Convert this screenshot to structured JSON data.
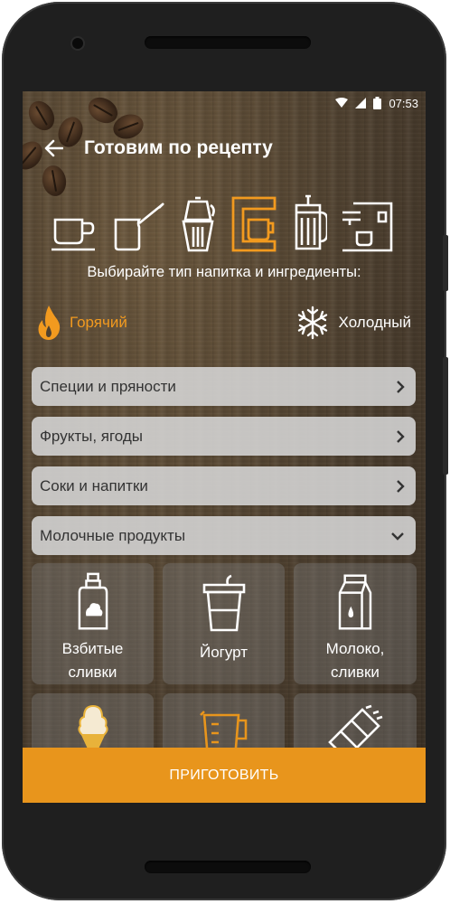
{
  "status_bar": {
    "time": "07:53"
  },
  "app_bar": {
    "title": "Готовим по рецепту",
    "back_icon": "arrow-left-icon"
  },
  "brew_methods": [
    {
      "name": "cup",
      "selected": false
    },
    {
      "name": "cezve",
      "selected": false
    },
    {
      "name": "moka-pot",
      "selected": false
    },
    {
      "name": "drip-coffee-maker",
      "selected": true
    },
    {
      "name": "french-press",
      "selected": false
    },
    {
      "name": "espresso-machine",
      "selected": false
    }
  ],
  "prompt": "Выбирайте тип напитка и ингредиенты:",
  "temperature": {
    "hot_label": "Горячий",
    "cold_label": "Холодный",
    "selected": "hot"
  },
  "categories": [
    {
      "label": "Специи и пряности",
      "icon": "chevron-right-icon"
    },
    {
      "label": "Фрукты, ягоды",
      "icon": "chevron-right-icon"
    },
    {
      "label": "Соки и напитки",
      "icon": "chevron-right-icon"
    },
    {
      "label": "Молочные продукты",
      "icon": "chevron-down-icon"
    }
  ],
  "dairy_items": [
    {
      "label": "Взбитые\nсливки",
      "icon": "whipped-cream-icon"
    },
    {
      "label": "Йогурт",
      "icon": "yogurt-icon"
    },
    {
      "label": "Молоко,\nсливки",
      "icon": "milk-carton-icon"
    },
    {
      "label": "",
      "icon": "ice-cream-icon"
    },
    {
      "label": "",
      "icon": "measuring-jug-icon"
    },
    {
      "label": "",
      "icon": "chocolate-icon"
    }
  ],
  "action_button": "ПРИГОТОВИТЬ",
  "colors": {
    "accent": "#e8951c",
    "hot": "#f29a1f",
    "panel": "#d6d6d6"
  }
}
